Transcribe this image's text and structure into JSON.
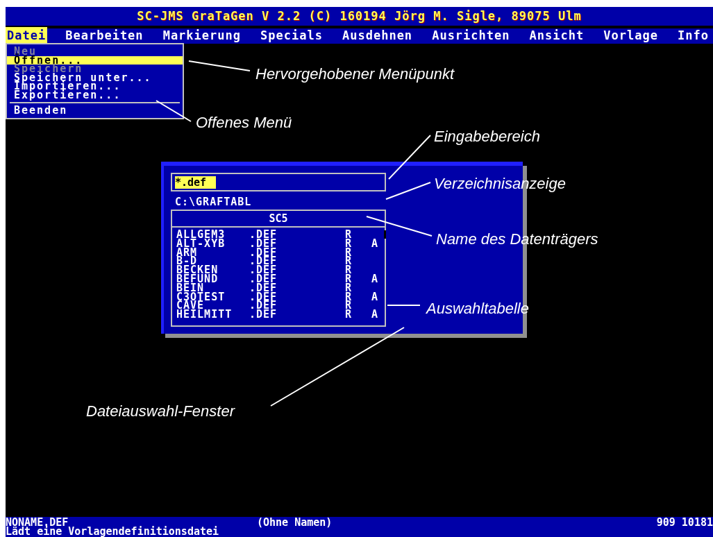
{
  "title": "SC-JMS GraTaGen V 2.2 (C) 160194 Jörg M. Sigle, 89075 Ulm",
  "menubar": [
    {
      "label": "Datei",
      "selected": true
    },
    {
      "label": "Bearbeiten",
      "selected": false
    },
    {
      "label": "Markierung",
      "selected": false
    },
    {
      "label": "Specials",
      "selected": false
    },
    {
      "label": "Ausdehnen",
      "selected": false
    },
    {
      "label": "Ausrichten",
      "selected": false
    },
    {
      "label": "Ansicht",
      "selected": false
    },
    {
      "label": "Vorlage",
      "selected": false
    },
    {
      "label": "Info",
      "selected": false
    }
  ],
  "menu": [
    {
      "kind": "item",
      "label": "Neu",
      "disabled": true,
      "selected": false
    },
    {
      "kind": "item",
      "label": "Öffnen...",
      "disabled": false,
      "selected": true
    },
    {
      "kind": "item",
      "label": "Speichern",
      "disabled": true,
      "selected": false
    },
    {
      "kind": "item",
      "label": "Speichern unter...",
      "disabled": false,
      "selected": false
    },
    {
      "kind": "item",
      "label": "Importieren...",
      "disabled": false,
      "selected": false
    },
    {
      "kind": "item",
      "label": "Exportieren...",
      "disabled": false,
      "selected": false
    },
    {
      "kind": "separator"
    },
    {
      "kind": "item",
      "label": "Beenden",
      "disabled": false,
      "selected": false
    }
  ],
  "dialog": {
    "input": "*.def",
    "path": "C:\\GRAFTABL",
    "volume": "SC5",
    "files": [
      {
        "name": "ALLGEM3",
        "ext": ".DEF",
        "column_3": "R"
      },
      {
        "name": "ALT-XYB",
        "ext": ".DEF",
        "column_3": "R",
        "column_4": "A"
      },
      {
        "name": "ARM",
        "ext": ".DEF",
        "column_3": "R"
      },
      {
        "name": "B-D",
        "ext": ".DEF",
        "column_3": "R"
      },
      {
        "name": "BECKEN",
        "ext": ".DEF",
        "column_3": "R"
      },
      {
        "name": "BEFUND",
        "ext": ".DEF",
        "column_3": "R",
        "column_4": "A"
      },
      {
        "name": "BEIN",
        "ext": ".DEF",
        "column_3": "R"
      },
      {
        "name": "C3OTEST",
        "ext": ".DEF",
        "column_3": "R",
        "column_4": "A"
      },
      {
        "name": "CAVE",
        "ext": ".DEF",
        "column_3": "R"
      },
      {
        "name": "HEILMITT",
        "ext": ".DEF",
        "column_3": "R",
        "column_4": "A"
      }
    ]
  },
  "status_bar": {
    "file": "NONAME.DEF",
    "name": "(Ohne Namen)",
    "numbers": "909 10181",
    "hint": "Lädt eine Vorlagendefinitionsdatei"
  },
  "annotations": [
    "Hervorgehobener Menüpunkt",
    "Offenes Menü",
    "Eingabebereich",
    "Verzeichnisanzeige",
    "Name des Datenträgers",
    "Auswahltabelle",
    "Dateiauswahl-Fenster"
  ]
}
